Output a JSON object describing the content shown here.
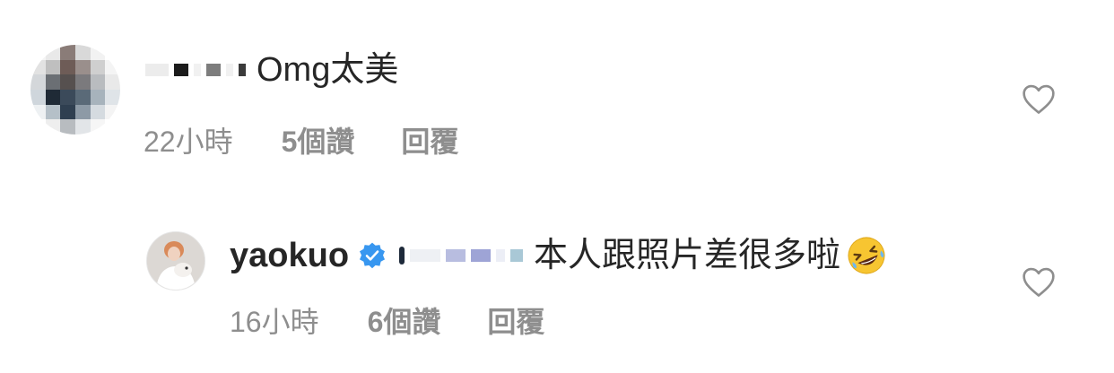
{
  "comments": [
    {
      "avatar": "pixelated-avatar",
      "username": "",
      "text": "Omg太美",
      "time": "22小時",
      "likes": "5個讚",
      "reply": "回覆",
      "icon": "heart-icon"
    },
    {
      "avatar": "profile-photo-avatar",
      "username": "yaokuo",
      "verified_icon": "verified-badge-icon",
      "text": "本人跟照片差很多啦",
      "emoji": "rolling-on-floor-laughing-emoji",
      "time": "16小時",
      "likes": "6個讚",
      "reply": "回覆",
      "icon": "heart-icon"
    }
  ],
  "colors": {
    "text": "#262626",
    "meta": "#8e8e8e",
    "verified": "#3897f0",
    "emoji": "#f7c531"
  }
}
